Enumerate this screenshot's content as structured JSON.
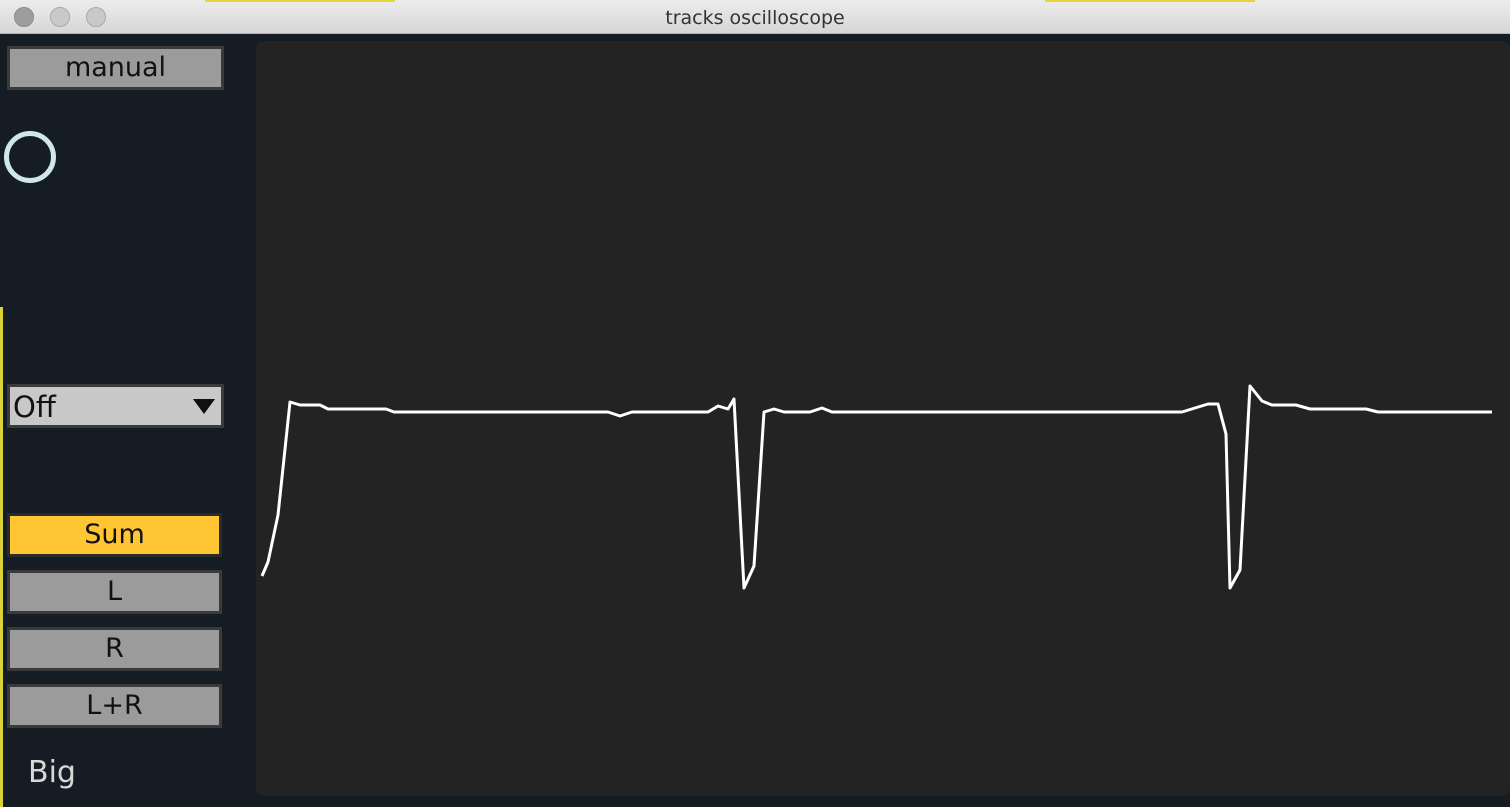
{
  "window": {
    "title": "tracks oscilloscope"
  },
  "controls": {
    "mode_button": "manual",
    "dropdown": {
      "selected": "Off"
    },
    "channels": [
      {
        "label": "Sum",
        "active": true
      },
      {
        "label": "L",
        "active": false
      },
      {
        "label": "R",
        "active": false
      },
      {
        "label": "L+R",
        "active": false
      }
    ],
    "size_label": "Big"
  },
  "colors": {
    "active_channel": "#ffc533",
    "button": "#9b9b9b",
    "scope_background": "#232323",
    "trace": "#ffffff",
    "indicator_ring": "#cfe6ea"
  },
  "icons": {
    "indicator": "circle-indicator-icon",
    "dropdown": "dropdown-arrow-icon"
  }
}
